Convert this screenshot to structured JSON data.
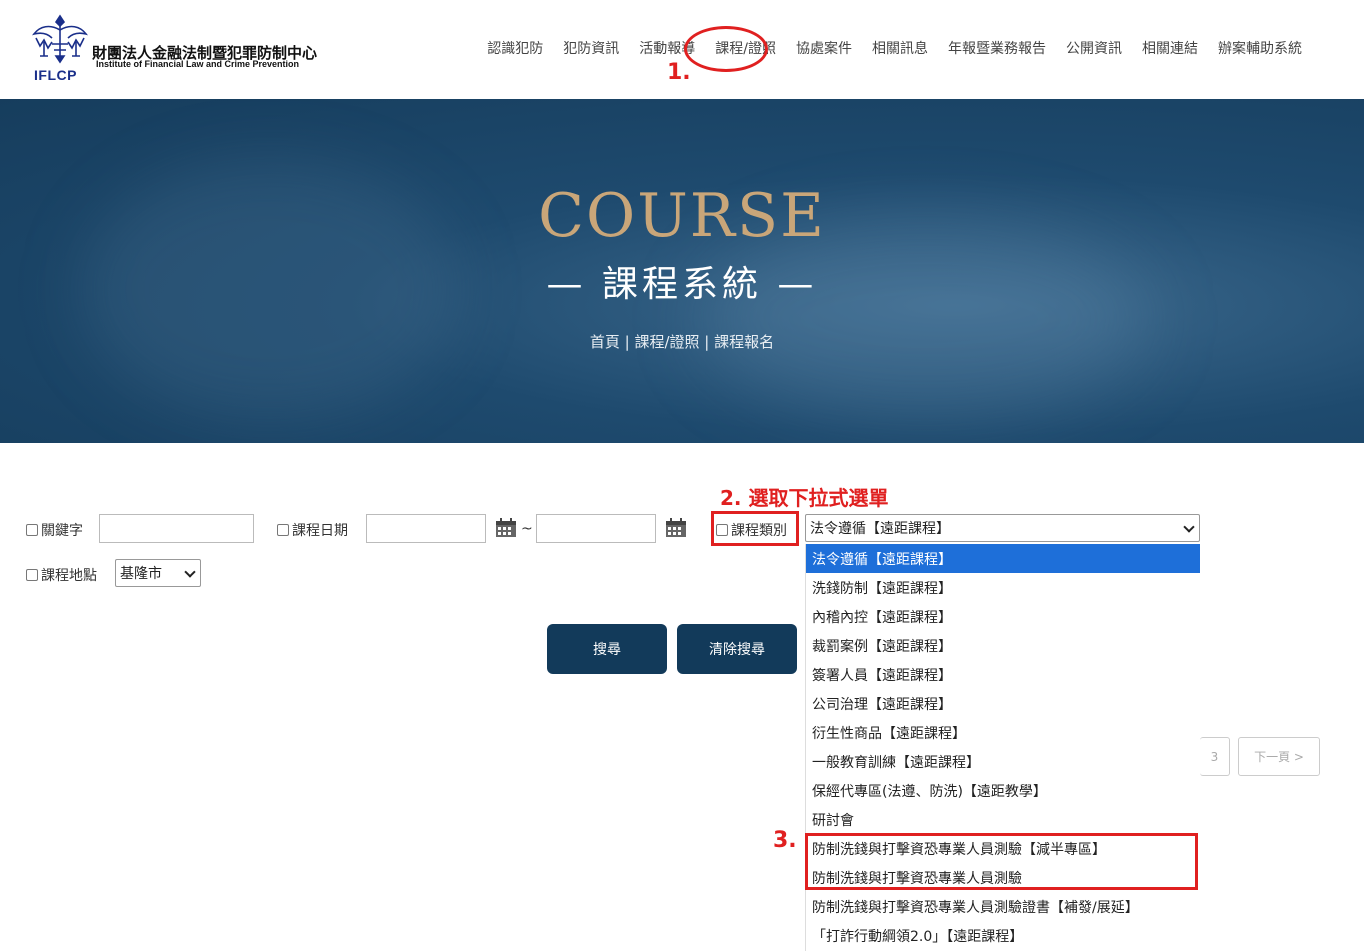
{
  "logo": {
    "name_cn": "財團法人金融法制暨犯罪防制中心",
    "name_en": "Institute of Financial Law and Crime Prevention",
    "abbr": "IFLCP"
  },
  "nav": [
    {
      "label": "認識犯防"
    },
    {
      "label": "犯防資訊"
    },
    {
      "label": "活動報導"
    },
    {
      "label": "課程/證照"
    },
    {
      "label": "協處案件"
    },
    {
      "label": "相關訊息"
    },
    {
      "label": "年報暨業務報告"
    },
    {
      "label": "公開資訊"
    },
    {
      "label": "相關連結"
    },
    {
      "label": "辦案輔助系統"
    }
  ],
  "hero": {
    "title": "COURSE",
    "subtitle": "—  課程系統  —",
    "breadcrumb": "首頁 | 課程/證照 | 課程報名"
  },
  "annotations": {
    "step1": "1.",
    "step2": "2. 選取下拉式選單",
    "step3": "3."
  },
  "filters": {
    "keyword_label": "關鍵字",
    "keyword_value": "",
    "date_label": "課程日期",
    "date_from": "",
    "date_to": "",
    "date_sep": "~",
    "category_label": "課程類別",
    "category_selected": "法令遵循【遠距課程】",
    "location_label": "課程地點",
    "location_selected": "基隆市"
  },
  "buttons": {
    "search": "搜尋",
    "clear": "清除搜尋"
  },
  "category_options": [
    "法令遵循【遠距課程】",
    "洗錢防制【遠距課程】",
    "內稽內控【遠距課程】",
    "裁罰案例【遠距課程】",
    "簽署人員【遠距課程】",
    "公司治理【遠距課程】",
    "衍生性商品【遠距課程】",
    "一般教育訓練【遠距課程】",
    "保經代專區(法遵、防洗)【遠距教學】",
    "研討會",
    "防制洗錢與打擊資恐專業人員測驗【減半專區】",
    "防制洗錢與打擊資恐專業人員測驗",
    "防制洗錢與打擊資恐專業人員測驗證書【補發/展延】",
    "「打詐行動綱領2.0」【遠距課程】"
  ],
  "pagination": {
    "page3": "3",
    "next": "下一頁 >"
  },
  "colors": {
    "primary": "#123a5a",
    "accent_gold": "#c9a679",
    "annotation_red": "#e02020",
    "highlight_blue": "#1e6fd9"
  }
}
